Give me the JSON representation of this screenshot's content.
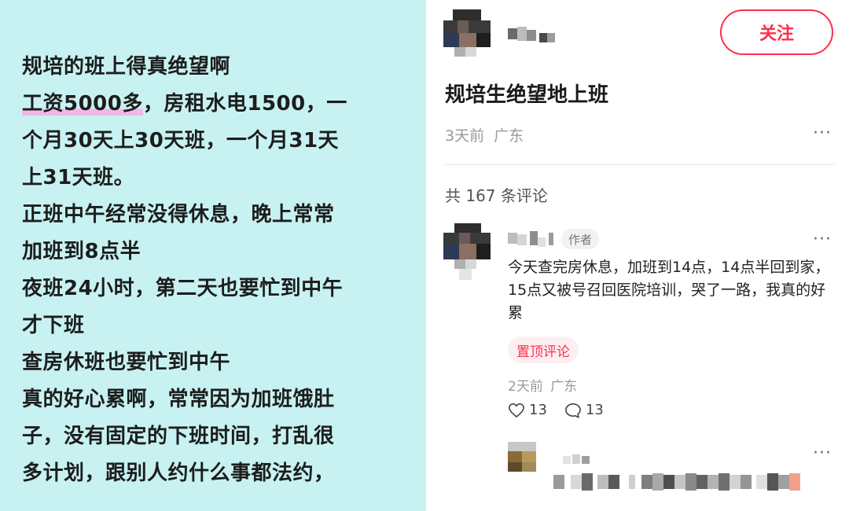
{
  "post_screenshot": {
    "lines": [
      {
        "pre": "规培的班上得真绝望啊",
        "hl": "",
        "post": ""
      },
      {
        "pre": "",
        "hl": "工资5000多",
        "post": "，房租水电1500，一"
      },
      {
        "pre": "个月30天上30天班，一个月31天",
        "hl": "",
        "post": ""
      },
      {
        "pre": "上31天班。",
        "hl": "",
        "post": ""
      },
      {
        "pre": "正班中午经常没得休息，晚上常常",
        "hl": "",
        "post": ""
      },
      {
        "pre": "加班到8点半",
        "hl": "",
        "post": ""
      },
      {
        "pre": "夜班24小时，第二天也要忙到中午",
        "hl": "",
        "post": ""
      },
      {
        "pre": "才下班",
        "hl": "",
        "post": ""
      },
      {
        "pre": "查房休班也要忙到中午",
        "hl": "",
        "post": ""
      },
      {
        "pre": "真的好心累啊，常常因为加班饿肚",
        "hl": "",
        "post": ""
      },
      {
        "pre": "子，没有固定的下班时间，打乱很",
        "hl": "",
        "post": ""
      },
      {
        "pre": "多计划，跟别人约什么事都法约，",
        "hl": "",
        "post": ""
      }
    ]
  },
  "header": {
    "follow_label": "关注"
  },
  "post": {
    "title": "规培生绝望地上班",
    "time": "3天前",
    "location": "广东",
    "more": "···"
  },
  "comments": {
    "count_label": "共 167 条评论"
  },
  "top_comment": {
    "author_badge": "作者",
    "text": "今天查完房休息，加班到14点，14点半回到家，15点又被号召回医院培训，哭了一路，我真的好累",
    "pinned_label": "置顶评论",
    "time": "2天前",
    "location": "广东",
    "likes": "13",
    "replies": "13",
    "more": "···"
  },
  "reply": {
    "more": "···"
  },
  "colors": {
    "accent": "#ff2e4d",
    "left_bg": "#c8f2f2",
    "highlight": "#f2b6e6"
  }
}
